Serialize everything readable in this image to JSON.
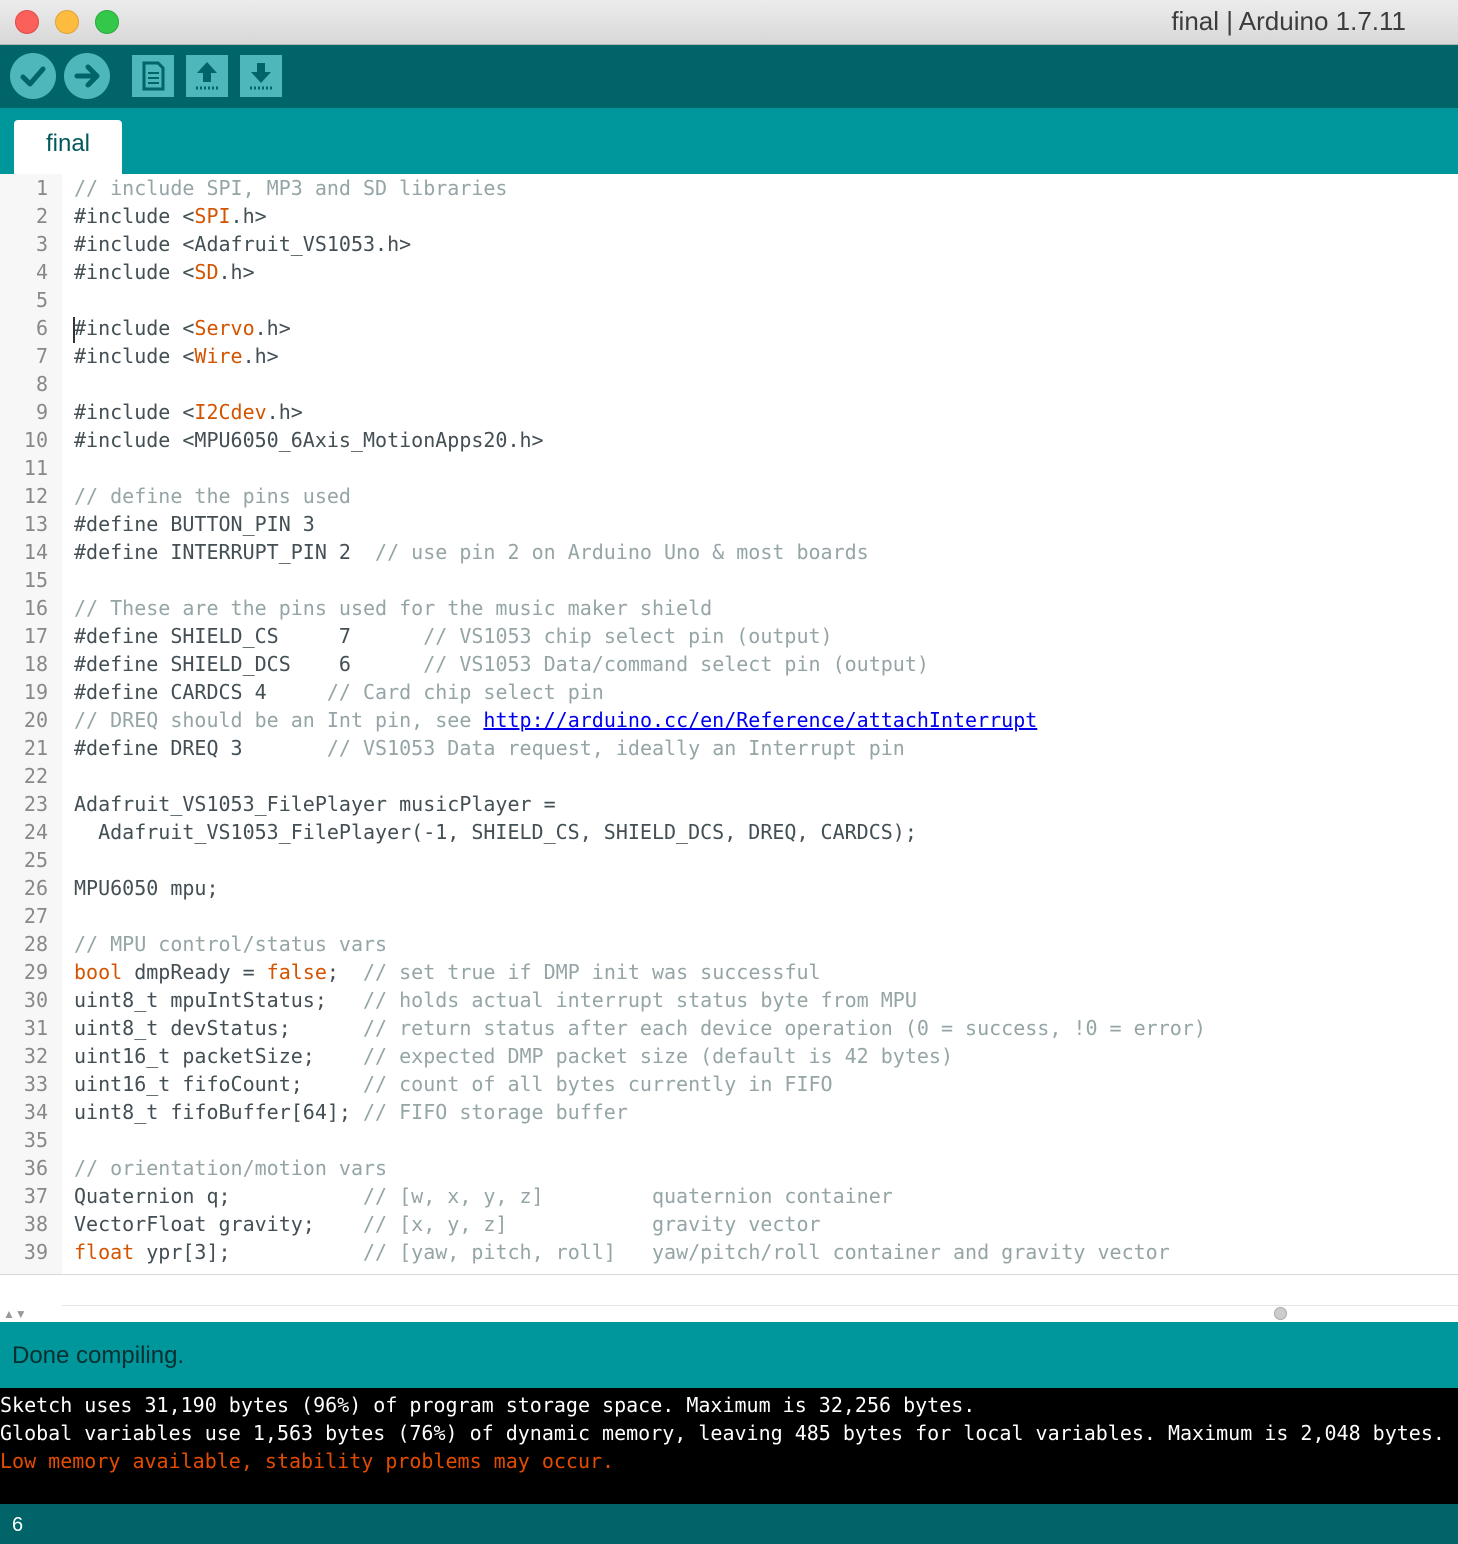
{
  "window": {
    "title": "final | Arduino 1.7.11"
  },
  "toolbar": {
    "verify_icon": "checkmark-icon",
    "upload_icon": "arrow-right-icon",
    "new_icon": "document-icon",
    "open_icon": "arrow-up-icon",
    "save_icon": "arrow-down-icon"
  },
  "tabs": [
    {
      "label": "final"
    }
  ],
  "editor": {
    "lines": [
      [
        [
          "c",
          "// include SPI, MP3 and SD libraries"
        ]
      ],
      [
        [
          "t",
          "#include <"
        ],
        [
          "k",
          "SPI"
        ],
        [
          "t",
          ".h>"
        ]
      ],
      [
        [
          "t",
          "#include <Adafruit_VS1053.h>"
        ]
      ],
      [
        [
          "t",
          "#include <"
        ],
        [
          "k",
          "SD"
        ],
        [
          "t",
          ".h>"
        ]
      ],
      [],
      [
        [
          "t",
          "#include <"
        ],
        [
          "k",
          "Servo"
        ],
        [
          "t",
          ".h>"
        ]
      ],
      [
        [
          "t",
          "#include <"
        ],
        [
          "k",
          "Wire"
        ],
        [
          "t",
          ".h>"
        ]
      ],
      [],
      [
        [
          "t",
          "#include <"
        ],
        [
          "k",
          "I2Cdev"
        ],
        [
          "t",
          ".h>"
        ]
      ],
      [
        [
          "t",
          "#include <MPU6050_6Axis_MotionApps20.h>"
        ]
      ],
      [],
      [
        [
          "c",
          "// define the pins used"
        ]
      ],
      [
        [
          "t",
          "#define BUTTON_PIN 3"
        ]
      ],
      [
        [
          "t",
          "#define INTERRUPT_PIN 2  "
        ],
        [
          "c",
          "// use pin 2 on Arduino Uno & most boards"
        ]
      ],
      [],
      [
        [
          "c",
          "// These are the pins used for the music maker shield"
        ]
      ],
      [
        [
          "t",
          "#define SHIELD_CS     7      "
        ],
        [
          "c",
          "// VS1053 chip select pin (output)"
        ]
      ],
      [
        [
          "t",
          "#define SHIELD_DCS    6      "
        ],
        [
          "c",
          "// VS1053 Data/command select pin (output)"
        ]
      ],
      [
        [
          "t",
          "#define CARDCS 4     "
        ],
        [
          "c",
          "// Card chip select pin"
        ]
      ],
      [
        [
          "c",
          "// DREQ should be an Int pin, see "
        ],
        [
          "u",
          "http://arduino.cc/en/Reference/attachInterrupt"
        ]
      ],
      [
        [
          "t",
          "#define DREQ 3       "
        ],
        [
          "c",
          "// VS1053 Data request, ideally an Interrupt pin"
        ]
      ],
      [],
      [
        [
          "t",
          "Adafruit_VS1053_FilePlayer musicPlayer ="
        ]
      ],
      [
        [
          "t",
          "  Adafruit_VS1053_FilePlayer(-1, SHIELD_CS, SHIELD_DCS, DREQ, CARDCS);"
        ]
      ],
      [],
      [
        [
          "t",
          "MPU6050 mpu;"
        ]
      ],
      [],
      [
        [
          "c",
          "// MPU control/status vars"
        ]
      ],
      [
        [
          "k",
          "bool"
        ],
        [
          "t",
          " dmpReady = "
        ],
        [
          "k",
          "false"
        ],
        [
          "t",
          ";  "
        ],
        [
          "c",
          "// set true if DMP init was successful"
        ]
      ],
      [
        [
          "t",
          "uint8_t mpuIntStatus;   "
        ],
        [
          "c",
          "// holds actual interrupt status byte from MPU"
        ]
      ],
      [
        [
          "t",
          "uint8_t devStatus;      "
        ],
        [
          "c",
          "// return status after each device operation (0 = success, !0 = error)"
        ]
      ],
      [
        [
          "t",
          "uint16_t packetSize;    "
        ],
        [
          "c",
          "// expected DMP packet size (default is 42 bytes)"
        ]
      ],
      [
        [
          "t",
          "uint16_t fifoCount;     "
        ],
        [
          "c",
          "// count of all bytes currently in FIFO"
        ]
      ],
      [
        [
          "t",
          "uint8_t fifoBuffer[64]; "
        ],
        [
          "c",
          "// FIFO storage buffer"
        ]
      ],
      [],
      [
        [
          "c",
          "// orientation/motion vars"
        ]
      ],
      [
        [
          "t",
          "Quaternion q;           "
        ],
        [
          "c",
          "// [w, x, y, z]         quaternion container"
        ]
      ],
      [
        [
          "t",
          "VectorFloat gravity;    "
        ],
        [
          "c",
          "// [x, y, z]            gravity vector"
        ]
      ],
      [
        [
          "k",
          "float"
        ],
        [
          "t",
          " ypr[3];           "
        ],
        [
          "c",
          "// [yaw, pitch, roll]   yaw/pitch/roll container and gravity vector"
        ]
      ]
    ]
  },
  "status": {
    "message": "Done compiling."
  },
  "console": {
    "lines": [
      {
        "text": "Sketch uses 31,190 bytes (96%) of program storage space. Maximum is 32,256 bytes.",
        "warn": false
      },
      {
        "text": "Global variables use 1,563 bytes (76%) of dynamic memory, leaving 485 bytes for local variables. Maximum is 2,048 bytes.",
        "warn": false
      },
      {
        "text": "Low memory available, stability problems may occur.",
        "warn": true
      }
    ]
  },
  "footer": {
    "line_number": "6"
  }
}
